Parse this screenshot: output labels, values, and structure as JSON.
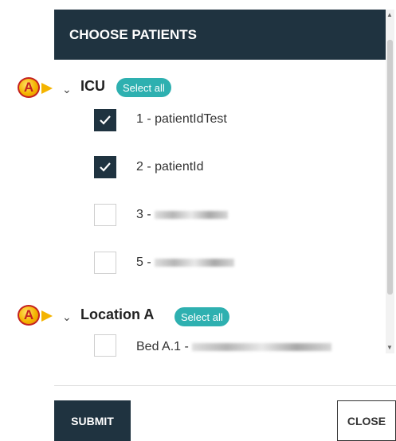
{
  "dialog": {
    "title": "CHOOSE PATIENTS"
  },
  "callout": {
    "letter": "A"
  },
  "groups": [
    {
      "label": "ICU",
      "select_all": "Select all",
      "patients": [
        {
          "label": "1 - patientIdTest",
          "checked": true
        },
        {
          "label": "2 - patientId",
          "checked": true
        },
        {
          "label": "3 -",
          "checked": false
        },
        {
          "label": "5 -",
          "checked": false
        }
      ]
    },
    {
      "label": "Location A",
      "select_all": "Select all",
      "patients": [
        {
          "label": "Bed A.1 -",
          "checked": false
        }
      ]
    }
  ],
  "footer": {
    "submit_label": "SUBMIT",
    "close_label": "CLOSE"
  },
  "colors": {
    "header": "#1f3340",
    "accent": "#2eb0b0",
    "callout": "#f4b400"
  }
}
